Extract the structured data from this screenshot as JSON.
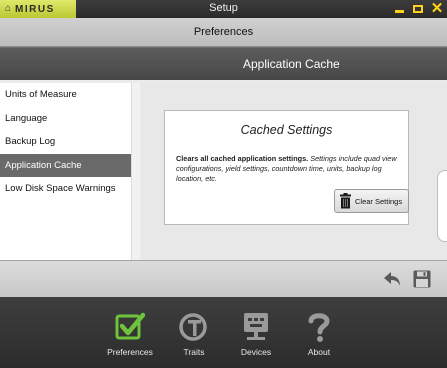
{
  "app": {
    "brand": "MIRUS",
    "window_title": "Setup"
  },
  "prefbar": {
    "title": "Preferences"
  },
  "header": {
    "section_title": "Application Cache"
  },
  "sidebar": {
    "items": [
      {
        "label": "Units of Measure",
        "selected": false
      },
      {
        "label": "Language",
        "selected": false
      },
      {
        "label": "Backup Log",
        "selected": false
      },
      {
        "label": "Application Cache",
        "selected": true
      },
      {
        "label": "Low Disk Space Warnings",
        "selected": false
      }
    ]
  },
  "panel": {
    "title": "Cached Settings",
    "lead": "Clears all cached application settings.",
    "description": "Settings include quad view configurations, yield settings, countdown time, units, backup log location, etc.",
    "clear_button": "Clear Settings"
  },
  "actions": {
    "undo_icon": "undo-arrow",
    "save_icon": "floppy-disk"
  },
  "bottom_nav": [
    {
      "label": "Preferences",
      "icon": "check-box-icon"
    },
    {
      "label": "Traits",
      "icon": "traits-icon"
    },
    {
      "label": "Devices",
      "icon": "device-icon"
    },
    {
      "label": "About",
      "icon": "question-icon"
    }
  ],
  "colors": {
    "accent": "#dbe624",
    "window_controls": "#ffd21a",
    "preferences_icon": "#6fc23b"
  }
}
